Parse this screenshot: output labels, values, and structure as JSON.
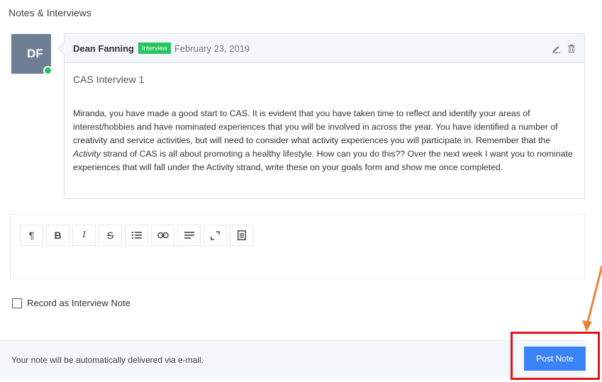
{
  "section": {
    "title": "Notes & Interviews"
  },
  "note": {
    "avatar_initials": "DF",
    "author": "Dean Fanning",
    "badge": "Interview",
    "date": "February 23, 2019",
    "title": "CAS Interview 1",
    "body_part1": "Miranda, you have made a good start to CAS.  It is evident that you have taken time to reflect and identify your areas of interest/hobbies and have nominated experiences that you will be involved in across the year.  You have identified a number of creativity and service activities, but will need to consider what activity experiences you will participate in.  Remember that the ",
    "body_emphasis": "Activity",
    "body_part2": " strand of CAS is all about promoting a healthy lifestyle.  How can you do this??  Over the next week I want you to nominate experiences that will fall under the Activity strand, write these on your goals form and show me once completed.",
    "icons": [
      "pencil-icon",
      "trash-icon"
    ]
  },
  "editor": {
    "toolbar": [
      {
        "name": "paragraph-button",
        "glyph": "¶"
      },
      {
        "name": "bold-button",
        "glyph": "B"
      },
      {
        "name": "italic-button",
        "glyph": "I"
      },
      {
        "name": "strikethrough-button",
        "glyph": "S"
      },
      {
        "name": "list-button",
        "glyph": "list-icon"
      },
      {
        "name": "link-button",
        "glyph": "link-icon"
      },
      {
        "name": "align-button",
        "glyph": "align-icon"
      },
      {
        "name": "fullscreen-button",
        "glyph": "expand-icon"
      },
      {
        "name": "source-button",
        "glyph": "document-icon"
      }
    ]
  },
  "checkbox": {
    "label": "Record as Interview Note",
    "checked": false
  },
  "footer": {
    "text": "Your note will be automatically delivered via e-mail.",
    "post_label": "Post Note"
  },
  "colors": {
    "accent": "#3b82f6",
    "badge": "#22c55e",
    "highlight": "#e0151b",
    "arrow": "#e8833a"
  }
}
